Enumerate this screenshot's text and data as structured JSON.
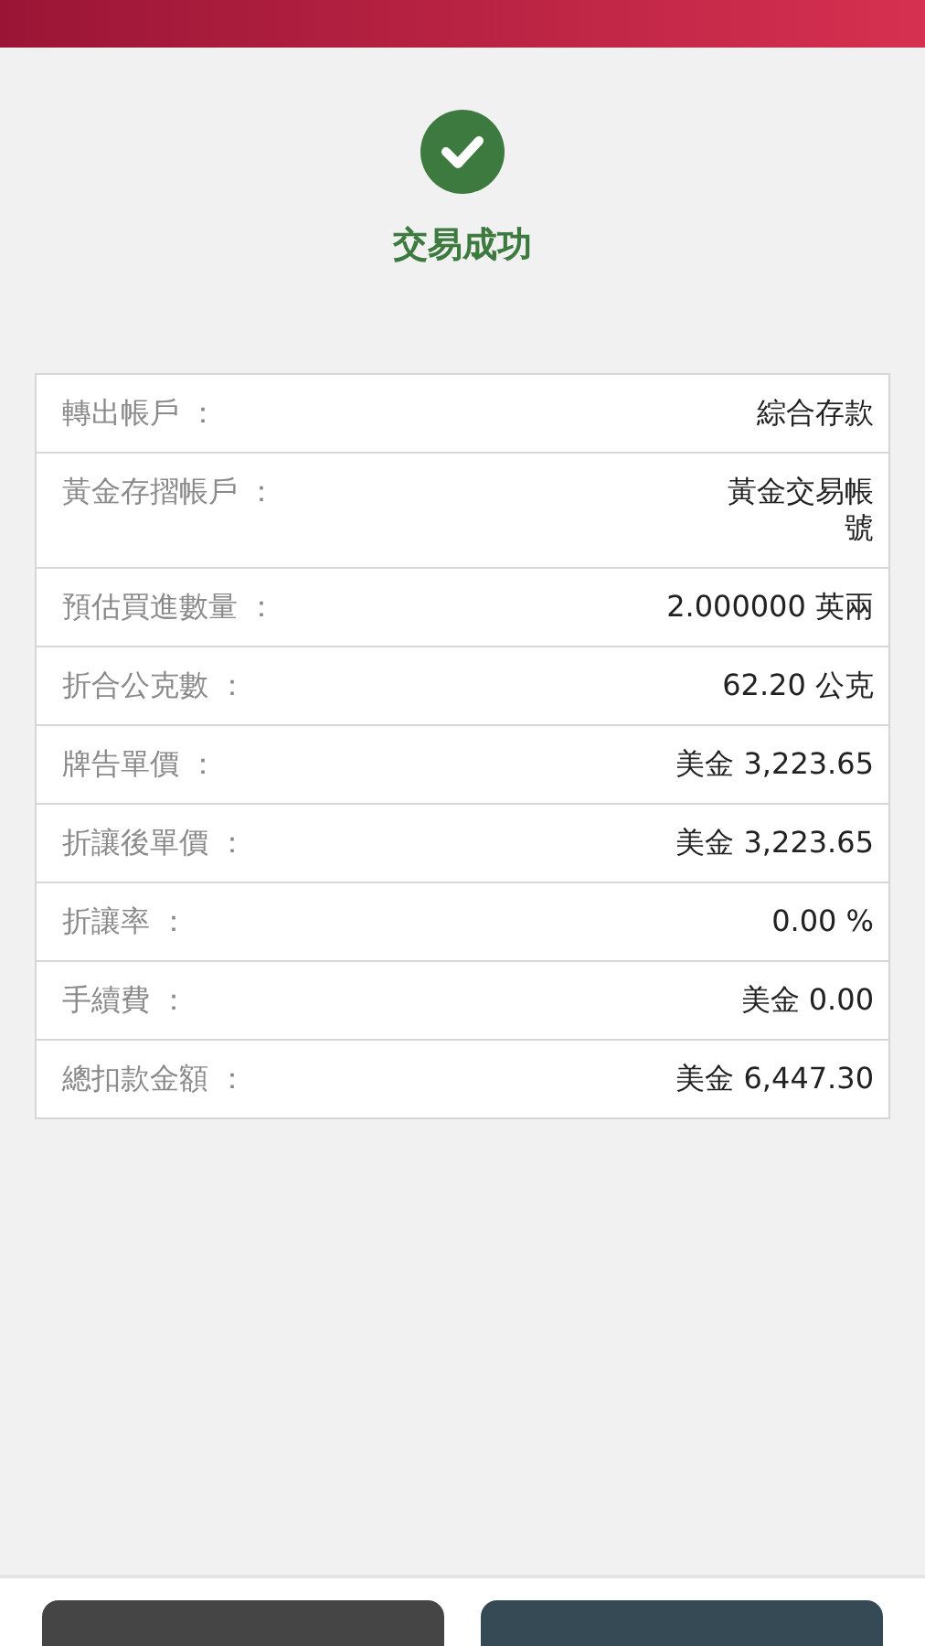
{
  "result": {
    "success": true,
    "message": "交易成功"
  },
  "details": [
    {
      "label": "轉出帳戶 ：",
      "value": "綜合存款"
    },
    {
      "label": "黃金存摺帳戶 ：",
      "value": "黃金交易帳號"
    },
    {
      "label": "預估買進數量 ：",
      "value": "2.000000 英兩"
    },
    {
      "label": "折合公克數 ：",
      "value": "62.20 公克"
    },
    {
      "label": "牌告單價 ：",
      "value": "美金 3,223.65"
    },
    {
      "label": "折讓後單價 ：",
      "value": "美金 3,223.65"
    },
    {
      "label": "折讓率 ：",
      "value": "0.00 %"
    },
    {
      "label": "手續費 ：",
      "value": "美金 0.00"
    },
    {
      "label": "總扣款金額 ：",
      "value": "美金 6,447.30"
    }
  ],
  "footer_buttons": [
    {
      "kind": "secondary"
    },
    {
      "kind": "primary"
    }
  ]
}
